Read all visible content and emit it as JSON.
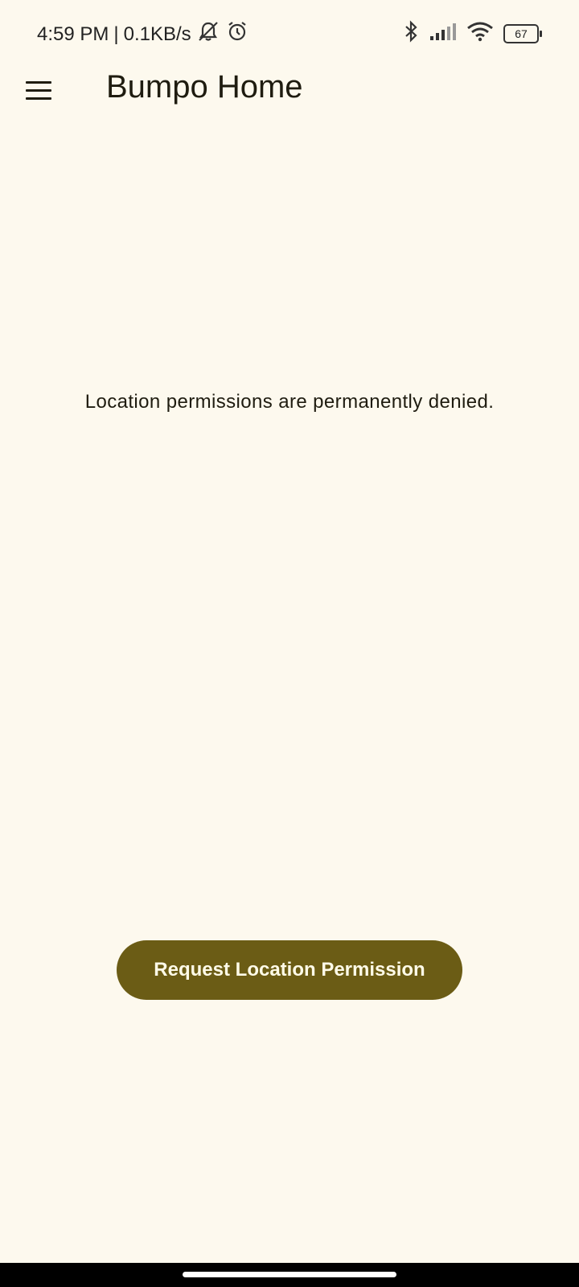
{
  "status_bar": {
    "time": "4:59 PM",
    "separator": "|",
    "net_speed": "0.1KB/s",
    "battery_level": "67",
    "icons": [
      "bell-off-icon",
      "alarm-icon",
      "bluetooth-icon",
      "signal-icon",
      "wifi-icon",
      "battery-icon"
    ]
  },
  "app_bar": {
    "title": "Bumpo Home",
    "menu_icon": "hamburger-menu-icon"
  },
  "main": {
    "message": "Location permissions are permanently denied.",
    "request_button_label": "Request Location Permission"
  },
  "colors": {
    "background": "#fdf9ee",
    "button": "#6b5c15",
    "button_text": "#fffbe8",
    "text": "#1f1c10"
  }
}
